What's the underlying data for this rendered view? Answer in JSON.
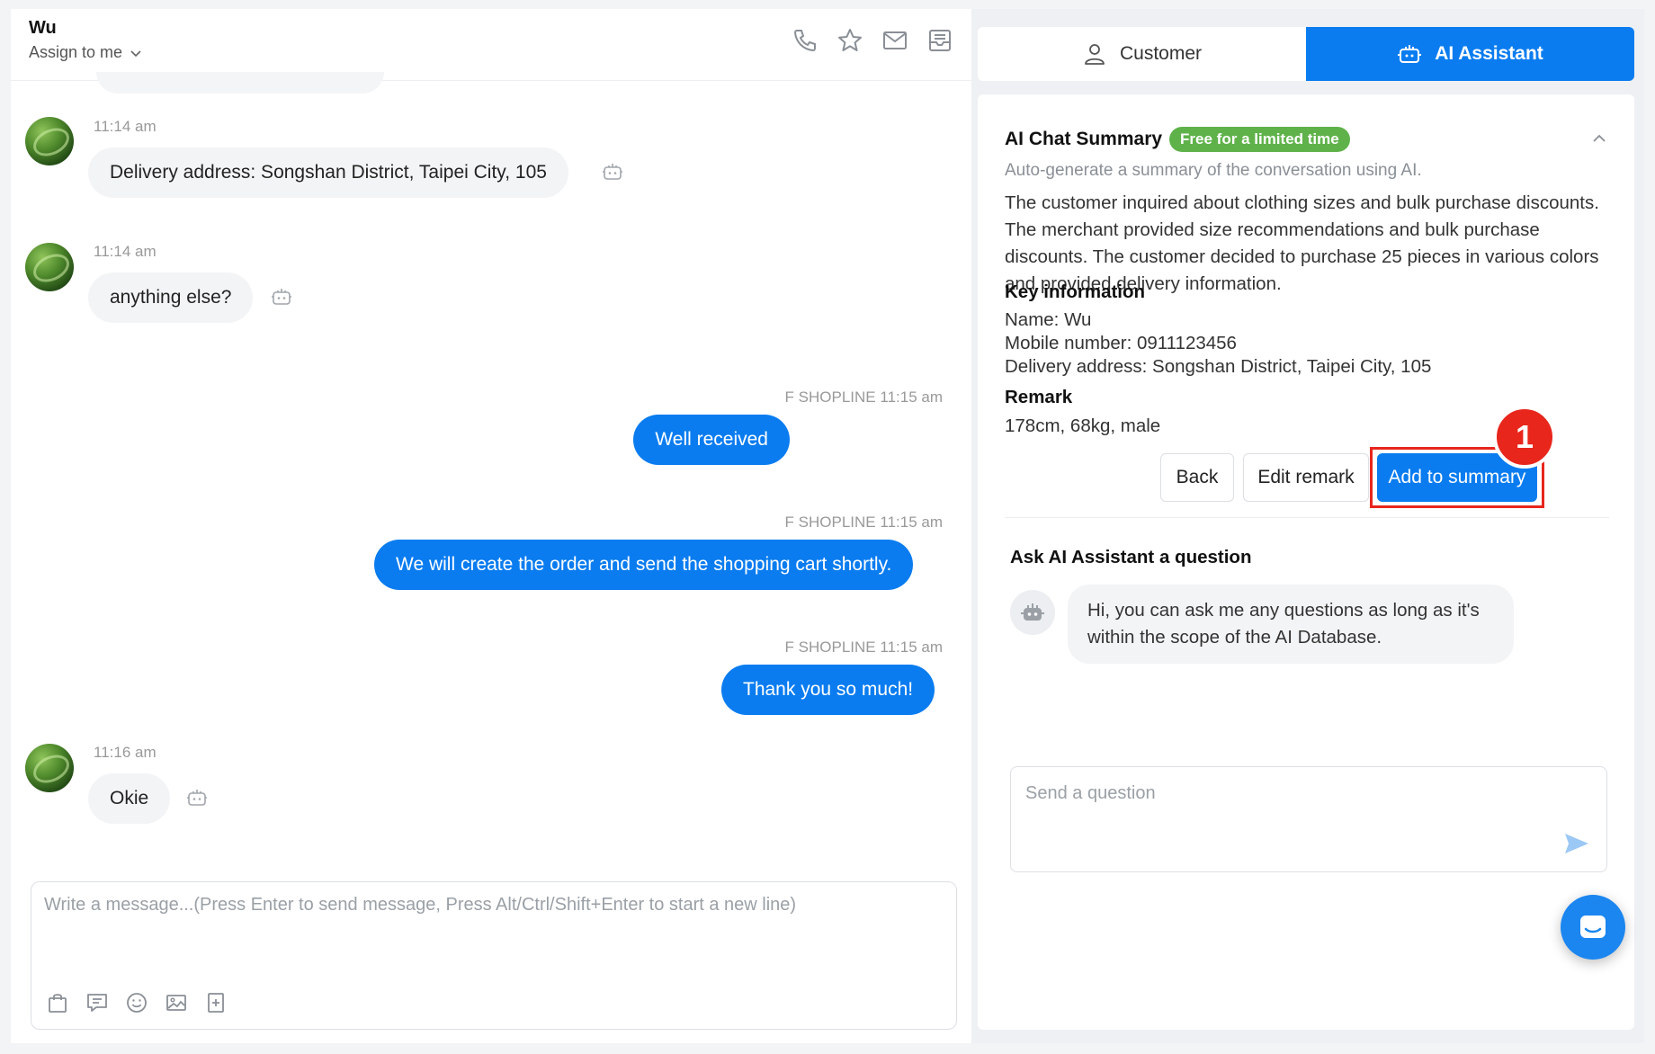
{
  "header": {
    "customer_name": "Wu",
    "assign_label": "Assign to me"
  },
  "icons": {
    "phone": "phone-icon",
    "star": "star-icon",
    "mail": "mail-icon",
    "inbox": "inbox-icon"
  },
  "messages": [
    {
      "direction": "in",
      "time": "11:14 am",
      "text": "Delivery address: Songshan District, Taipei City, 105"
    },
    {
      "direction": "in",
      "time": "11:14 am",
      "text": "anything else?"
    },
    {
      "direction": "out",
      "sender": "F SHOPLINE",
      "time": "11:15 am",
      "text": "Well received"
    },
    {
      "direction": "out",
      "sender": "F SHOPLINE",
      "time": "11:15 am",
      "text": "We will create the order and send the shopping cart shortly."
    },
    {
      "direction": "out",
      "sender": "F SHOPLINE",
      "time": "11:15 am",
      "text": "Thank you so much!"
    },
    {
      "direction": "in",
      "time": "11:16 am",
      "text": "Okie"
    }
  ],
  "composer": {
    "placeholder": "Write a message...(Press Enter to send message, Press Alt/Ctrl/Shift+Enter to start a new line)"
  },
  "tabs": {
    "customer": "Customer",
    "ai_assistant": "AI Assistant"
  },
  "summary": {
    "title": "AI Chat Summary",
    "badge": "Free for a limited time",
    "subtitle": "Auto-generate a summary of the conversation using AI.",
    "body": "The customer inquired about clothing sizes and bulk purchase discounts. The merchant provided size recommendations and bulk purchase discounts. The customer decided to purchase 25 pieces in various colors and provided delivery information.",
    "key_info_heading": "Key information",
    "name_line": "Name: Wu",
    "mobile_line": "Mobile number: 0911123456",
    "address_line": "Delivery address: Songshan District, Taipei City, 105",
    "remark_heading": "Remark",
    "remark_value": "178cm, 68kg, male",
    "back_label": "Back",
    "edit_remark_label": "Edit remark",
    "add_to_summary_label": "Add to summary",
    "step_number": "1"
  },
  "ask": {
    "title": "Ask AI Assistant a question",
    "bot_message": "Hi, you can ask me any questions as long as it's within the scope of the AI Database.",
    "question_placeholder": "Send a question"
  },
  "colors": {
    "primary": "#0a7cf0",
    "badge_green": "#5fb24a",
    "highlight_red": "#e8261c"
  }
}
